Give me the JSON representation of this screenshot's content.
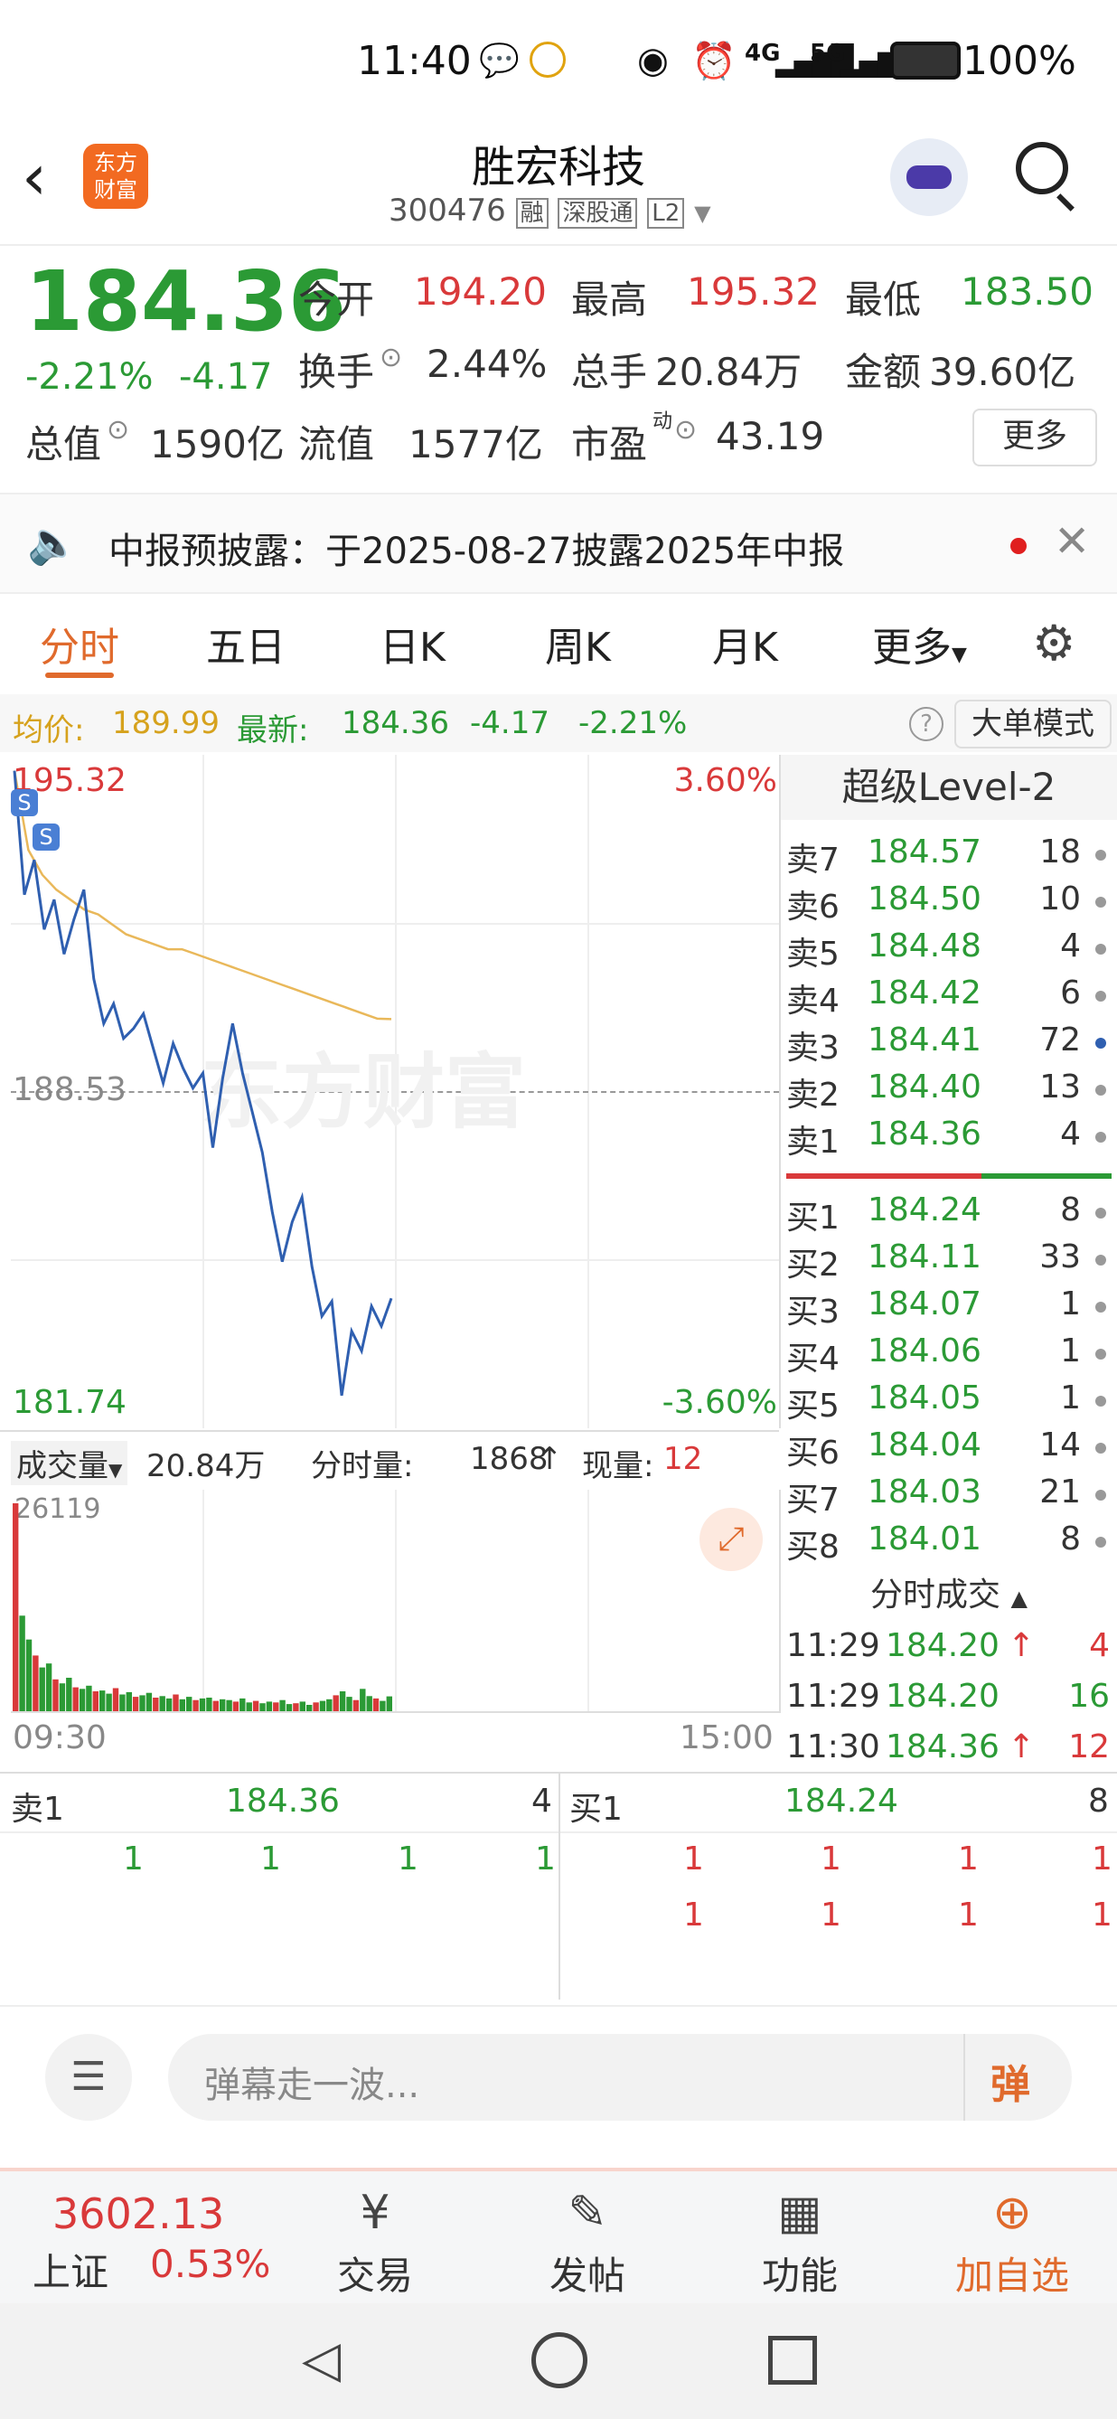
{
  "status_bar": {
    "time": "11:40",
    "network_4g": "4G",
    "network_5g": "5G",
    "battery": "100%"
  },
  "header": {
    "logo_text": "东方\n财富",
    "title": "胜宏科技",
    "code": "300476",
    "badges": [
      "融",
      "深股通",
      "L2"
    ]
  },
  "quote": {
    "price": "184.36",
    "change_pct": "-2.21%",
    "change": "-4.17",
    "open_label": "今开",
    "open": "194.20",
    "high_label": "最高",
    "high": "195.32",
    "low_label": "最低",
    "low": "183.50",
    "turnover_label": "换手",
    "turnover": "2.44%",
    "volume_label": "总手",
    "volume": "20.84万",
    "amount_label": "金额",
    "amount": "39.60亿",
    "mktcap_label": "总值",
    "mktcap": "1590亿",
    "float_label": "流值",
    "float_cap": "1577亿",
    "pe_label": "市盈",
    "pe_sup": "动",
    "pe": "43.19",
    "more_button": "更多"
  },
  "notice": {
    "text": "中报预披露：于2025-08-27披露2025年中报"
  },
  "tabs": [
    "分时",
    "五日",
    "日K",
    "周K",
    "月K",
    "更多"
  ],
  "info_bar": {
    "avg_label": "均价:",
    "avg": "189.99",
    "latest_label": "最新:",
    "latest": "184.36",
    "change": "-4.17",
    "change_pct": "-2.21%",
    "help": "?",
    "mode_button": "大单模式"
  },
  "chart": {
    "y_max_label": "195.32",
    "y_mid_label": "188.53",
    "y_min_label": "181.74",
    "pct_max_label": "3.60%",
    "pct_min_label": "-3.60%",
    "watermark": "东方财富",
    "markers": [
      "S",
      "S"
    ],
    "volume_selector": "成交量",
    "volume_value": "20.84万",
    "minute_vol_label": "分时量:",
    "minute_vol": "1868",
    "current_vol_label": "现量:",
    "current_vol": "12",
    "vol_max_label": "26119",
    "time_start": "09:30",
    "time_end": "15:00"
  },
  "chart_data": {
    "type": "line",
    "title": "",
    "ylim": [
      181.74,
      195.32
    ],
    "series": [
      {
        "values": [
          195.0,
          192.5,
          193.2,
          191.8,
          192.4,
          191.3,
          192.0,
          192.6,
          190.8,
          189.9,
          190.3,
          189.6,
          189.8,
          190.1,
          189.4,
          188.7,
          189.5,
          189.0,
          188.6,
          188.9,
          187.4,
          188.8,
          189.9,
          188.9,
          188.1,
          187.3,
          186.1,
          185.1,
          185.9,
          186.4,
          185.0,
          184.0,
          184.3,
          182.4,
          183.7,
          183.3,
          184.2,
          183.8,
          184.36
        ]
      },
      {
        "values": [
          195.0,
          193.4,
          192.9,
          192.6,
          192.4,
          192.2,
          192.1,
          191.9,
          191.7,
          191.6,
          191.5,
          191.4,
          191.4,
          191.3,
          191.2,
          191.1,
          191.0,
          190.9,
          190.8,
          190.7,
          190.6,
          190.5,
          190.4,
          190.3,
          190.2,
          190.1,
          190.0,
          189.99
        ]
      }
    ],
    "volume": [
      26119,
      12000,
      9000,
      7000,
      5500,
      6000,
      4000,
      3500,
      4200,
      3000,
      2800,
      3200,
      2500,
      2600,
      2200,
      2900,
      2100,
      2400,
      1800,
      2000,
      2300,
      1700,
      1900,
      1600,
      2100,
      1500,
      1800,
      1400,
      1600,
      1700,
      1300,
      1500,
      1400,
      1200,
      1600,
      1100,
      1300,
      1000,
      1200,
      1100,
      1400,
      900,
      1000,
      1200,
      800,
      1100,
      1300,
      1500,
      2000,
      2500,
      1800,
      1400,
      2800,
      1900,
      1600,
      1300,
      1868
    ]
  },
  "orderbook": {
    "title": "超级Level-2",
    "asks": [
      {
        "label": "卖7",
        "price": "184.57",
        "vol": "18"
      },
      {
        "label": "卖6",
        "price": "184.50",
        "vol": "10"
      },
      {
        "label": "卖5",
        "price": "184.48",
        "vol": "4"
      },
      {
        "label": "卖4",
        "price": "184.42",
        "vol": "6"
      },
      {
        "label": "卖3",
        "price": "184.41",
        "vol": "72"
      },
      {
        "label": "卖2",
        "price": "184.40",
        "vol": "13"
      },
      {
        "label": "卖1",
        "price": "184.36",
        "vol": "4"
      }
    ],
    "bids": [
      {
        "label": "买1",
        "price": "184.24",
        "vol": "8"
      },
      {
        "label": "买2",
        "price": "184.11",
        "vol": "33"
      },
      {
        "label": "买3",
        "price": "184.07",
        "vol": "1"
      },
      {
        "label": "买4",
        "price": "184.06",
        "vol": "1"
      },
      {
        "label": "买5",
        "price": "184.05",
        "vol": "1"
      },
      {
        "label": "买6",
        "price": "184.04",
        "vol": "14"
      },
      {
        "label": "买7",
        "price": "184.03",
        "vol": "21"
      },
      {
        "label": "买8",
        "price": "184.01",
        "vol": "8"
      }
    ],
    "ticks_title": "分时成交",
    "ticks": [
      {
        "time": "11:29",
        "price": "184.20",
        "vol": "4",
        "arrow": "↑"
      },
      {
        "time": "11:29",
        "price": "184.20",
        "vol": "16",
        "arrow": ""
      },
      {
        "time": "11:30",
        "price": "184.36",
        "vol": "12",
        "arrow": "↑"
      }
    ]
  },
  "queue": {
    "sell_label": "卖1",
    "sell_price": "184.36",
    "sell_vol": "4",
    "buy_label": "买1",
    "buy_price": "184.24",
    "buy_vol": "8",
    "sell_items": [
      "1",
      "1",
      "1",
      "1"
    ],
    "buy_items_row1": [
      "1",
      "1",
      "1",
      "1"
    ],
    "buy_items_row2": [
      "1",
      "1",
      "1",
      "1"
    ]
  },
  "comment": {
    "placeholder": "弹幕走一波...",
    "send_label": "弹"
  },
  "bottom_nav": {
    "index_value": "3602.13",
    "index_name": "上证",
    "index_change": "0.53%",
    "items": [
      "交易",
      "发帖",
      "功能",
      "加自选"
    ]
  }
}
